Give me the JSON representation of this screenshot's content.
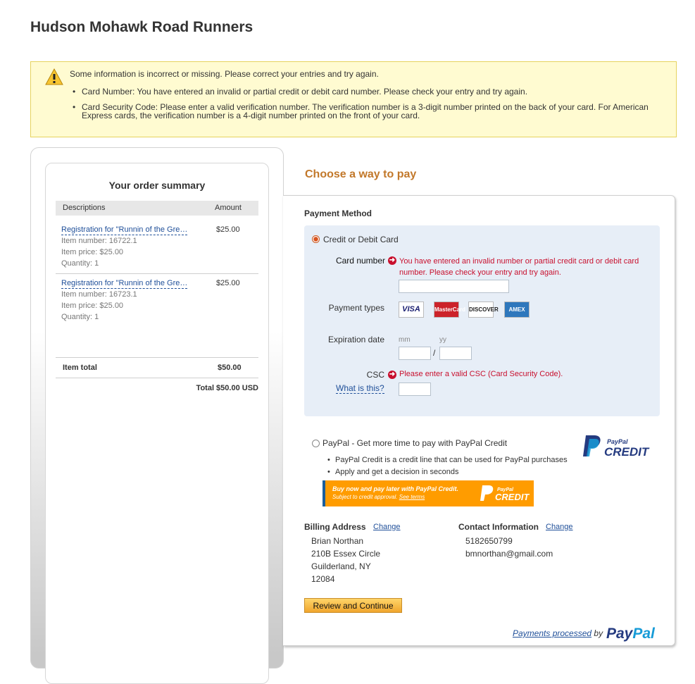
{
  "header": {
    "store_name": "Hudson Mohawk Road Runners"
  },
  "error_banner": {
    "icon": "warning-icon",
    "message": "Some information is incorrect or missing. Please correct your entries and try again.",
    "errors": [
      "Card Number: You have entered an invalid or partial credit or debit card number. Please check your entry and try again.",
      "Card Security Code: Please enter a valid verification number. The verification number is a 3-digit number printed on the back of your card. For American Express cards, the verification number is a 4-digit number printed on the front of your card."
    ]
  },
  "order_summary": {
    "title": "Your order summary",
    "col_desc": "Descriptions",
    "col_amount": "Amount",
    "items": [
      {
        "name": "Registration for \"Runnin of the Gre…",
        "number": "Item number: 16722.1",
        "price": "Item price: $25.00",
        "quantity": "Quantity: 1",
        "amount": "$25.00"
      },
      {
        "name": "Registration for \"Runnin of the Gre…",
        "number": "Item number: 16723.1",
        "price": "Item price: $25.00",
        "quantity": "Quantity: 1",
        "amount": "$25.00"
      }
    ],
    "item_total_label": "Item total",
    "item_total_value": "$50.00",
    "grand_total": "Total $50.00 USD"
  },
  "payment": {
    "choose_title": "Choose a way to pay",
    "method_label": "Payment Method",
    "card_option": "Credit or Debit Card",
    "card_number_label": "Card number",
    "card_number_error": "You have entered an invalid number or partial credit card or debit card number. Please check your entry and try again.",
    "card_number_value": "",
    "payment_types_label": "Payment types",
    "card_types": [
      "VISA",
      "MasterCard",
      "DISCOVER",
      "AMEX"
    ],
    "expiration_label": "Expiration date",
    "mm_placeholder": "mm",
    "yy_placeholder": "yy",
    "slash": "/",
    "csc_label": "CSC",
    "csc_error": "Please enter a valid CSC (Card Security Code).",
    "what_is_this": "What is this?",
    "paypal_option": "PayPal - Get more time to pay with PayPal Credit",
    "paypal_bullets": [
      "PayPal Credit is a credit line that can be used for PayPal purchases",
      "Apply and get a decision in seconds"
    ],
    "banner_line1": "Buy now and pay later with PayPal Credit.",
    "banner_line2": "Subject to credit approval.",
    "banner_link": "See terms",
    "ppc_logo_small": "PayPal",
    "ppc_logo_big": "CREDIT"
  },
  "billing": {
    "title": "Billing Address",
    "change": "Change",
    "lines": [
      "Brian Northan",
      "210B Essex Circle",
      "Guilderland, NY",
      "12084"
    ]
  },
  "contact": {
    "title": "Contact Information",
    "change": "Change",
    "lines": [
      "5182650799",
      "bmnorthan@gmail.com"
    ]
  },
  "actions": {
    "review_button": "Review and Continue"
  },
  "footer": {
    "processed_link": "Payments processed",
    "processed_by": "by",
    "paypal_pay": "Pay",
    "paypal_pal": "Pal"
  },
  "colors": {
    "accent_orange": "#c2782a",
    "error_red": "#c8102e",
    "link_blue": "#1f4f99",
    "banner_yellow": "#fffbd1"
  }
}
